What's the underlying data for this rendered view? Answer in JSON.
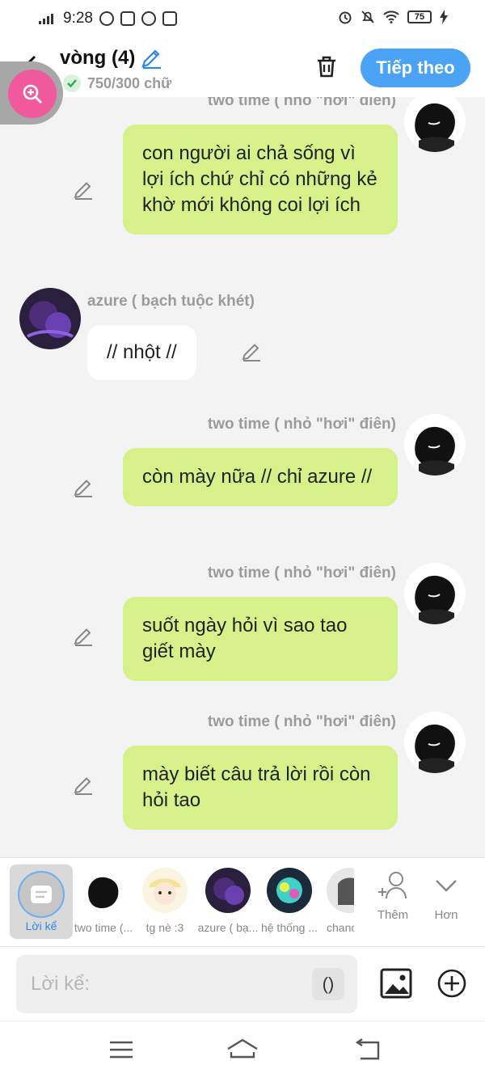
{
  "status": {
    "time": "9:28",
    "battery": "75"
  },
  "header": {
    "title": "vòng (4)",
    "word_count": "750/300 chữ",
    "next_label": "Tiếp theo"
  },
  "messages": [
    {
      "side": "right",
      "name": "two time ( nhỏ \"hơi\" điên)",
      "text": "con người ai chả sống vì lợi ích chứ chỉ có những kẻ khờ mới không coi lợi ích"
    },
    {
      "side": "left",
      "name": "azure ( bạch tuộc khét)",
      "text": "// nhột //"
    },
    {
      "side": "right",
      "name": "two time ( nhỏ \"hơi\" điên)",
      "text": "còn mày nữa // chỉ azure //"
    },
    {
      "side": "right",
      "name": "two time ( nhỏ \"hơi\" điên)",
      "text": "suốt ngày hỏi vì sao tao giết mày"
    },
    {
      "side": "right",
      "name": "two time ( nhỏ \"hơi\" điên)",
      "text": "mày biết câu trả lời rồi còn hỏi tao"
    }
  ],
  "characters": {
    "narrator": "Lời kể",
    "items": [
      "two time (...",
      "tg nè :3",
      "azure ( bạ...",
      "hệ thống ...",
      "chanc"
    ],
    "add_label": "Thêm",
    "more_label": "Hơn"
  },
  "input": {
    "placeholder": "Lời kể:",
    "paren": "()"
  }
}
